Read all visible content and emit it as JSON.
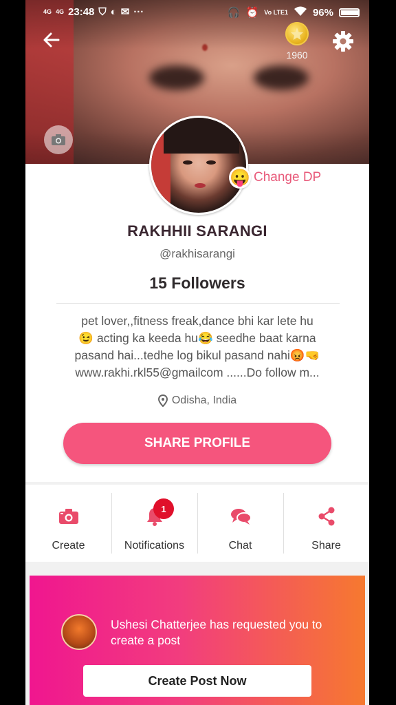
{
  "statusbar": {
    "signal1": "4G",
    "signal2": "4G",
    "time": "23:48",
    "more": "···",
    "volte": "Vo LTE1",
    "battery": "96%",
    "battery_level": 0.96
  },
  "header": {
    "coins": "1960"
  },
  "profile": {
    "change_dp_emoji": "😛",
    "change_dp_label": "Change DP",
    "name": "RAKHHII SARANGI",
    "handle": "@rakhisarangi",
    "followers": "15 Followers",
    "bio_lines": [
      "pet lover,,fitness freak,dance bhi kar lete hu",
      "😉 acting ka keeda hu😂 seedhe baat karna",
      "pasand hai...tedhe log bikul pasand nahi😡🤜",
      "www.rakhi.rkl55@gmailcom ......Do follow m..."
    ],
    "location": "Odisha, India",
    "share_label": "SHARE PROFILE"
  },
  "actions": [
    {
      "label": "Create",
      "icon": "camera-icon"
    },
    {
      "label": "Notifications",
      "icon": "bell-icon",
      "badge": "1"
    },
    {
      "label": "Chat",
      "icon": "chat-icon"
    },
    {
      "label": "Share",
      "icon": "share-icon"
    }
  ],
  "request": {
    "text": "Ushesi Chatterjee has requested you to create a post",
    "button": "Create Post Now"
  },
  "colors": {
    "accent": "#f5557d",
    "change_dp": "#e85a7a",
    "icon": "#e94b6a",
    "badge": "#e0102b",
    "gradient_start": "#f0168f",
    "gradient_end": "#f6792f"
  }
}
